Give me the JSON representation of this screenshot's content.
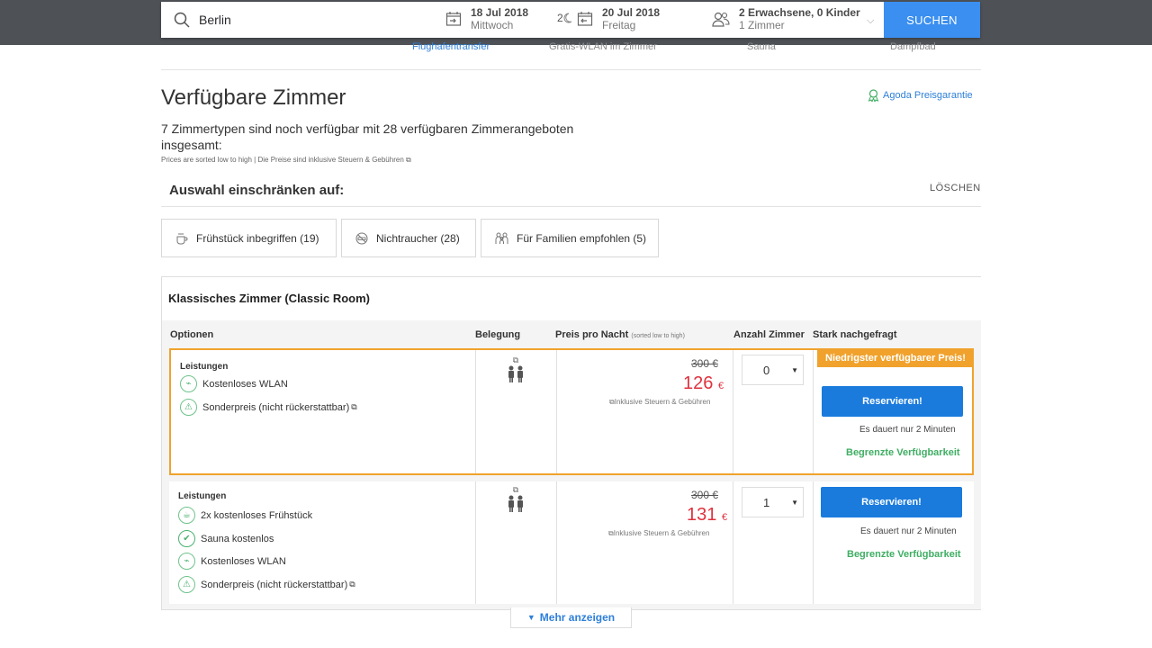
{
  "search": {
    "destination": "Berlin",
    "checkin_date": "18 Jul 2018",
    "checkin_day": "Mittwoch",
    "nights": "2",
    "checkout_date": "20 Jul 2018",
    "checkout_day": "Freitag",
    "guests": "2 Erwachsene, 0 Kinder",
    "rooms": "1 Zimmer",
    "submit_label": "SUCHEN"
  },
  "amenities": [
    "Flughafentransfer",
    "Gratis-WLAN im Zimmer",
    "Sauna",
    "Dampfbad"
  ],
  "heading": "Verfügbare Zimmer",
  "guarantee_label": "Agoda Preisgarantie",
  "subtitle": "7 Zimmertypen sind noch verfügbar mit 28 verfügbaren Zimmerangeboten insgesamt:",
  "sort_note": "Prices are sorted low to high | Die Preise sind inklusive Steuern & Gebühren",
  "filter": {
    "title": "Auswahl einschränken auf:",
    "clear_label": "LÖSCHEN",
    "chips": [
      {
        "label": "Frühstück inbegriffen (19)",
        "icon": "coffee-icon"
      },
      {
        "label": "Nichtraucher (28)",
        "icon": "no-smoking-icon"
      },
      {
        "label": "Für Familien empfohlen (5)",
        "icon": "family-icon"
      }
    ]
  },
  "room": {
    "title": "Klassisches Zimmer (Classic Room)",
    "columns": {
      "options": "Optionen",
      "occupancy": "Belegung",
      "price": "Preis pro Nacht",
      "price_note": "(sorted low to high)",
      "quantity": "Anzahl Zimmer",
      "demand": "Stark nachgefragt"
    },
    "offers": [
      {
        "section_label": "Leistungen",
        "features": [
          "Kostenloses WLAN",
          "Sonderpreis (nicht rückerstattbar)"
        ],
        "old_price": "300 €",
        "price": "126",
        "currency": "€",
        "tax_note": "Inklusive Steuern & Gebühren",
        "quantity": "0",
        "badge": "Niedrigster verfügbarer Preis!",
        "reserve_label": "Reservieren!",
        "duration": "Es dauert nur 2 Minuten",
        "availability": "Begrenzte Verfügbarkeit"
      },
      {
        "section_label": "Leistungen",
        "features": [
          "2x kostenloses Frühstück",
          "Sauna kostenlos",
          "Kostenloses WLAN",
          "Sonderpreis (nicht rückerstattbar)"
        ],
        "old_price": "300 €",
        "price": "131",
        "currency": "€",
        "tax_note": "Inklusive Steuern & Gebühren",
        "quantity": "1",
        "reserve_label": "Reservieren!",
        "duration": "Es dauert nur 2 Minuten",
        "availability": "Begrenzte Verfügbarkeit"
      }
    ]
  },
  "more_label": "Mehr anzeigen",
  "colors": {
    "accent": "#1a7bdc",
    "highlight": "#f0a22d",
    "price": "#e0323e",
    "success": "#3fae63",
    "header": "#4e5257"
  }
}
